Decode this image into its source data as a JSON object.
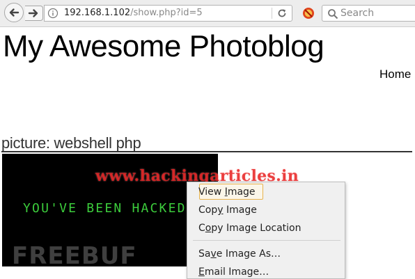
{
  "browser": {
    "url": {
      "host": "192.168.1.102",
      "path": "/show.php?id=5"
    },
    "search_placeholder": "Search",
    "icons": [
      "back-arrow-icon",
      "forward-arrow-icon",
      "info-icon",
      "reload-icon",
      "blocked-addon-icon",
      "search-icon"
    ]
  },
  "page": {
    "site_title": "My Awesome Photoblog",
    "nav": {
      "home": "Home",
      "separator": " |"
    },
    "picture_heading": "picture: webshell php",
    "image_text": "YOU'VE BEEN HACKED",
    "watermark_logo": "FREEBUF",
    "watermark_site": "www.hackingarticles.in"
  },
  "context_menu": {
    "items": [
      {
        "pre": "View ",
        "key": "I",
        "post": "mage"
      },
      {
        "pre": "Cop",
        "key": "y",
        "post": " Image"
      },
      {
        "pre": "C",
        "key": "o",
        "post": "py Image Location"
      },
      {
        "pre": "Sa",
        "key": "v",
        "post": "e Image As…"
      },
      {
        "pre": "",
        "key": "E",
        "post": "mail Image…"
      }
    ]
  },
  "colors": {
    "hacked_text": "#3ccc3c",
    "watermark_site": "#e61e1e",
    "menu_highlight_border": "#e8b34d"
  }
}
